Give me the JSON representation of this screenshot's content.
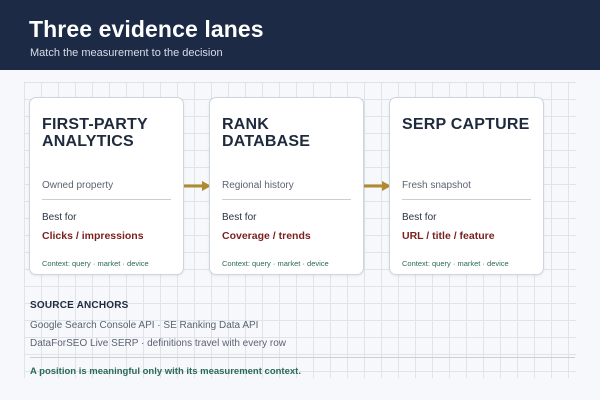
{
  "header": {
    "title": "Three evidence lanes",
    "subtitle": "Match the measurement to the decision"
  },
  "lanes": [
    {
      "title": "FIRST-PARTY ANALYTICS",
      "meta": "Owned property",
      "best_for_label": "Best for",
      "best_for_value": "Clicks / impressions",
      "context": "Context: query · market · device"
    },
    {
      "title": "RANK DATABASE",
      "meta": "Regional history",
      "best_for_label": "Best for",
      "best_for_value": "Coverage / trends",
      "context": "Context: query · market · device"
    },
    {
      "title": "SERP CAPTURE",
      "meta": "Fresh snapshot",
      "best_for_label": "Best for",
      "best_for_value": "URL / title / feature",
      "context": "Context: query · market · device"
    }
  ],
  "sources": {
    "label": "SOURCE ANCHORS",
    "lines": [
      "Google Search Console API · SE Ranking Data API",
      "DataForSEO Live SERP · definitions travel with every row"
    ]
  },
  "footer_note": "A position is meaningful only with its measurement context.",
  "colors": {
    "header_bg": "#1c2a45",
    "accent_value": "#7a1f1f",
    "context_green": "#2a6a55",
    "arrow_gold": "#b08a2e"
  }
}
